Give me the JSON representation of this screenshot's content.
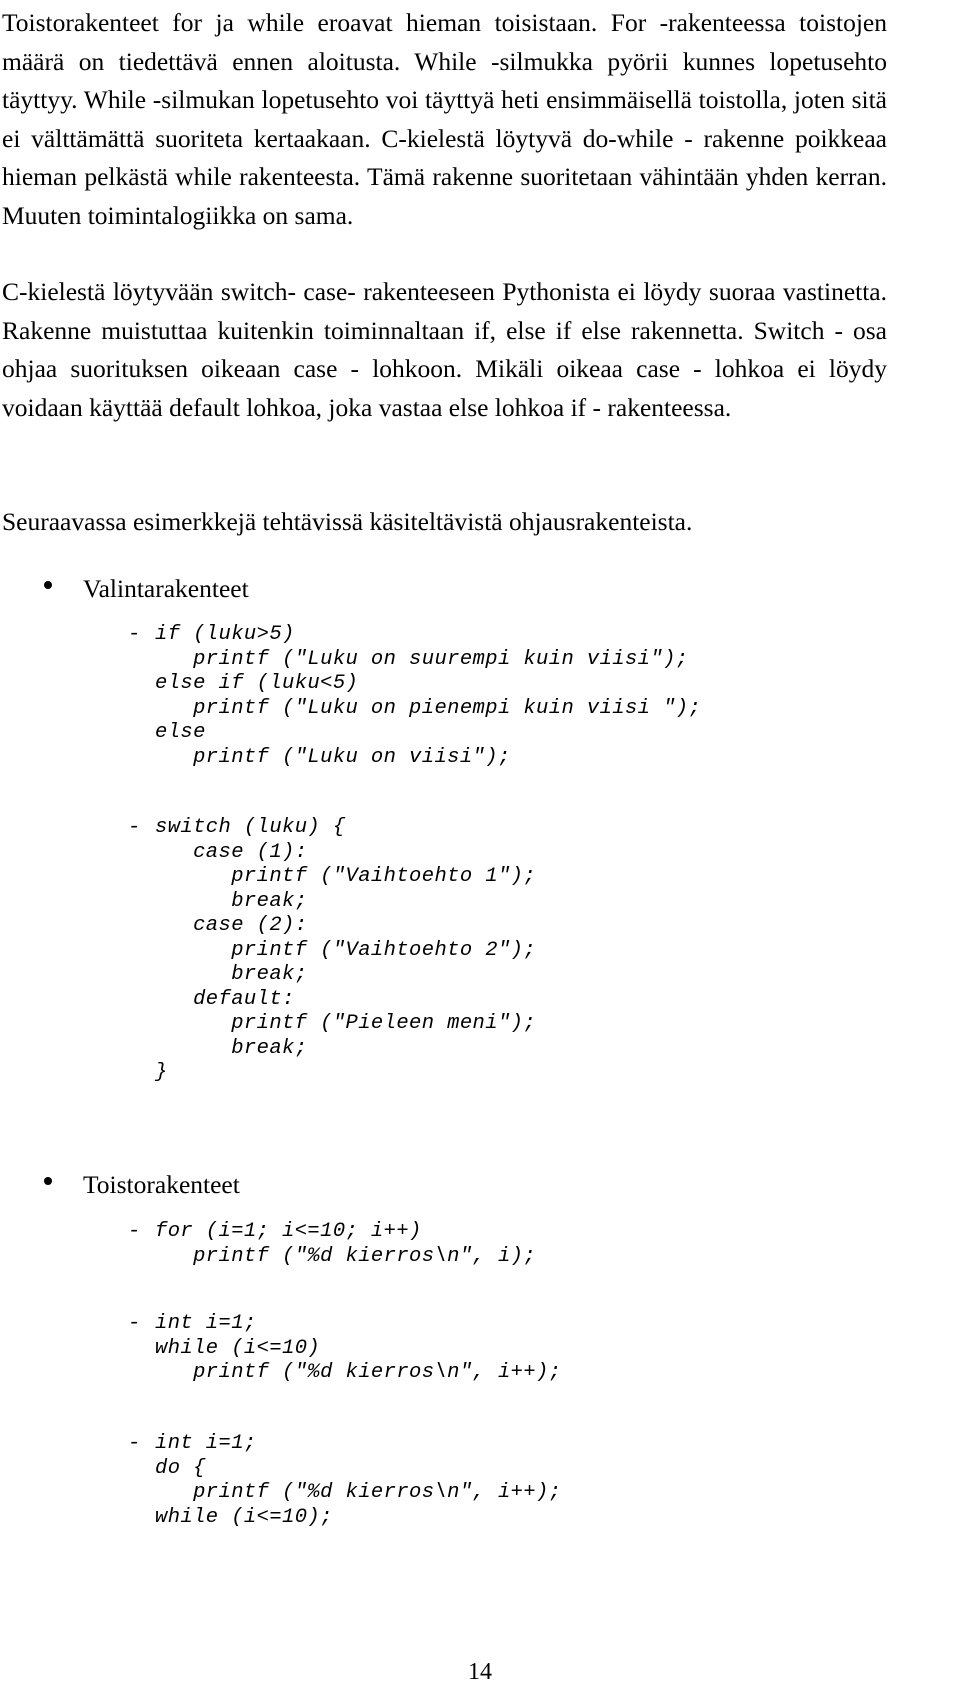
{
  "document": {
    "page_number": "14",
    "language": "fi",
    "paragraphs": [
      "Toistorakenteet for ja while eroavat hieman toisistaan. For -rakenteessa toistojen määrä on tiedettävä ennen aloitusta. While -silmukka pyörii kunnes lopetusehto täyttyy. While -silmukan lopetusehto voi täyttyä heti ensimmäisellä toistolla, joten sitä ei välttämättä suoriteta kertaakaan. C-kielestä löytyvä do-while - rakenne poikkeaa hieman pelkästä while rakenteesta. Tämä rakenne suoritetaan vähintään yhden kerran. Muuten toimintalogiikka on sama.",
      "C-kielestä löytyvään switch- case- rakenteeseen Pythonista ei löydy suoraa vastinetta. Rakenne muistuttaa kuitenkin toiminnaltaan if, else if else rakennetta. Switch - osa ohjaa suorituksen oikeaan case - lohkoon. Mikäli oikeaa case - lohkoa ei löydy voidaan käyttää default lohkoa, joka vastaa else lohkoa if - rakenteessa.",
      "Seuraavassa esimerkkejä tehtävissä käsiteltävistä ohjausrakenteista."
    ],
    "sections": [
      {
        "bullet_label": "Valintarakenteet",
        "code_examples": [
          {
            "dash": "-",
            "code": "if (luku>5)\n   printf (\"Luku on suurempi kuin viisi\");\nelse if (luku<5)\n   printf (\"Luku on pienempi kuin viisi \");\nelse\n   printf (\"Luku on viisi\");"
          },
          {
            "dash": "-",
            "code": "switch (luku) {\n   case (1):\n      printf (\"Vaihtoehto 1\");\n      break;\n   case (2):\n      printf (\"Vaihtoehto 2\");\n      break;\n   default:\n      printf (\"Pieleen meni\");\n      break;\n}"
          }
        ]
      },
      {
        "bullet_label": "Toistorakenteet",
        "code_examples": [
          {
            "dash": "-",
            "code": "for (i=1; i<=10; i++)\n   printf (\"%d kierros\\n\", i);"
          },
          {
            "dash": "-",
            "code": "int i=1;\nwhile (i<=10)\n   printf (\"%d kierros\\n\", i++);"
          },
          {
            "dash": "-",
            "code": "int i=1;\ndo {\n   printf (\"%d kierros\\n\", i++);\nwhile (i<=10);"
          }
        ]
      }
    ]
  }
}
